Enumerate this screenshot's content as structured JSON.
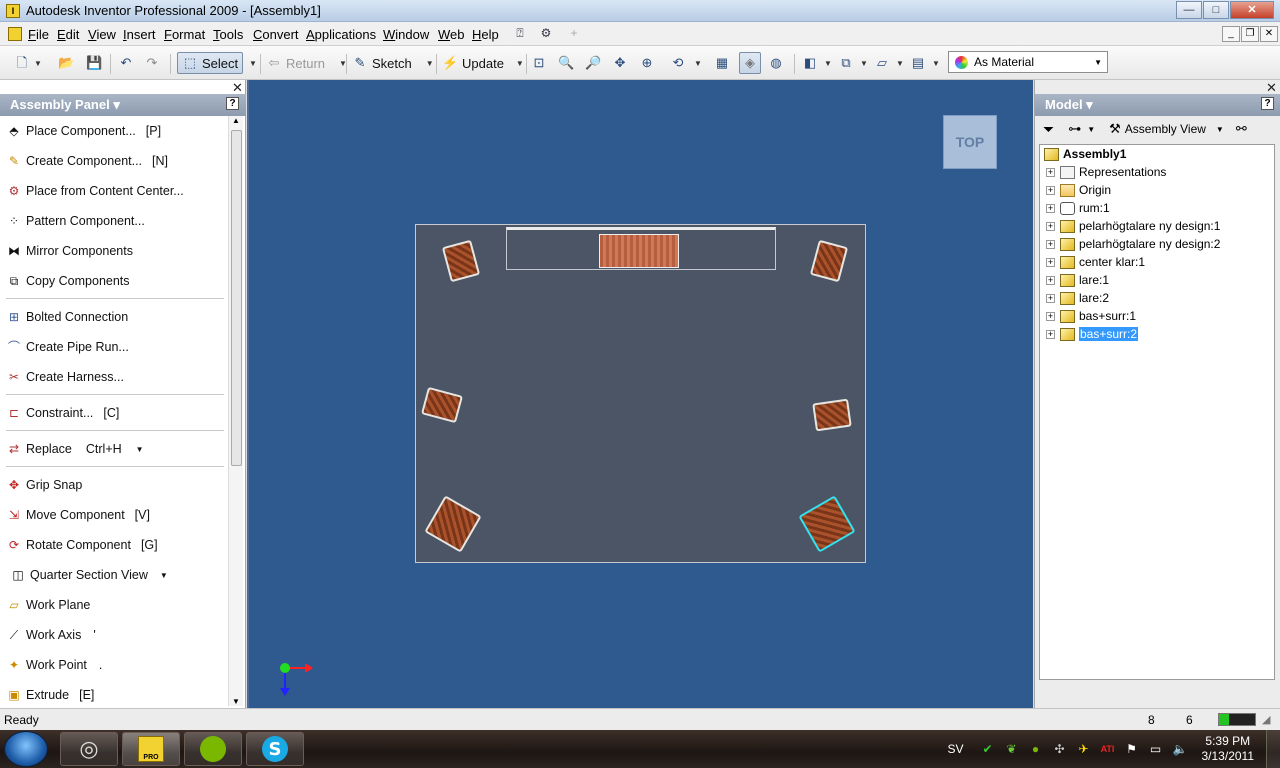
{
  "window": {
    "title": "Autodesk Inventor Professional 2009 - [Assembly1]",
    "app_icon": "I",
    "buttons": {
      "minimize": "—",
      "maximize": "□",
      "close": "✕"
    },
    "mdi_buttons": {
      "minimize": "_",
      "restore": "❐",
      "close": "✕"
    }
  },
  "menu": {
    "items": [
      "File",
      "Edit",
      "View",
      "Insert",
      "Format",
      "Tools",
      "Convert",
      "Applications",
      "Window",
      "Web",
      "Help"
    ]
  },
  "toolbar": {
    "select_label": "Select",
    "return_label": "Return",
    "sketch_label": "Sketch",
    "update_label": "Update",
    "material_value": "As Material"
  },
  "assembly_panel": {
    "title": "Assembly Panel ▾",
    "help": "?",
    "close": "✕",
    "commands": [
      {
        "label": "Place Component...",
        "shortcut": "[P]"
      },
      {
        "label": "Create Component...",
        "shortcut": "[N]"
      },
      {
        "label": "Place from Content Center...",
        "shortcut": ""
      },
      {
        "label": "Pattern Component...",
        "shortcut": ""
      },
      {
        "label": "Mirror Components",
        "shortcut": ""
      },
      {
        "label": "Copy Components",
        "shortcut": ""
      },
      {
        "label": "Bolted Connection",
        "shortcut": ""
      },
      {
        "label": "Create Pipe Run...",
        "shortcut": ""
      },
      {
        "label": "Create Harness...",
        "shortcut": ""
      },
      {
        "label": "Constraint...",
        "shortcut": "[C]"
      },
      {
        "label": "Replace",
        "shortcut": "Ctrl+H"
      },
      {
        "label": "Grip Snap",
        "shortcut": ""
      },
      {
        "label": "Move Component",
        "shortcut": "[V]"
      },
      {
        "label": "Rotate Component",
        "shortcut": "[G]"
      },
      {
        "label": "Quarter Section View",
        "shortcut": ""
      },
      {
        "label": "Work Plane",
        "shortcut": ""
      },
      {
        "label": "Work Axis",
        "shortcut": "'"
      },
      {
        "label": "Work Point",
        "shortcut": "."
      },
      {
        "label": "Extrude",
        "shortcut": "[E]"
      }
    ]
  },
  "viewport": {
    "viewcube_label": "TOP",
    "background_color": "#2e5a8f"
  },
  "model_panel": {
    "title": "Model ▾",
    "help": "?",
    "close": "✕",
    "view_selector": "Assembly View",
    "tree": [
      {
        "label": "Assembly1",
        "icon": "assembly-icon",
        "bold": true
      },
      {
        "label": "Representations",
        "icon": "representations-icon"
      },
      {
        "label": "Origin",
        "icon": "folder-icon"
      },
      {
        "label": "rum:1",
        "icon": "part-icon"
      },
      {
        "label": "pelarhögtalare ny design:1",
        "icon": "part-icon"
      },
      {
        "label": "pelarhögtalare ny design:2",
        "icon": "part-icon"
      },
      {
        "label": "center klar:1",
        "icon": "part-icon"
      },
      {
        "label": "lare:1",
        "icon": "part-icon"
      },
      {
        "label": "lare:2",
        "icon": "part-icon"
      },
      {
        "label": "bas+surr:1",
        "icon": "part-icon"
      },
      {
        "label": "bas+surr:2",
        "icon": "part-icon",
        "selected": true
      }
    ]
  },
  "status": {
    "text": "Ready",
    "count_a": "8",
    "count_b": "6",
    "accent": "#22c422"
  },
  "taskbar": {
    "language": "SV",
    "time": "5:39 PM",
    "date": "3/13/2011",
    "pro_label": "PRO"
  }
}
